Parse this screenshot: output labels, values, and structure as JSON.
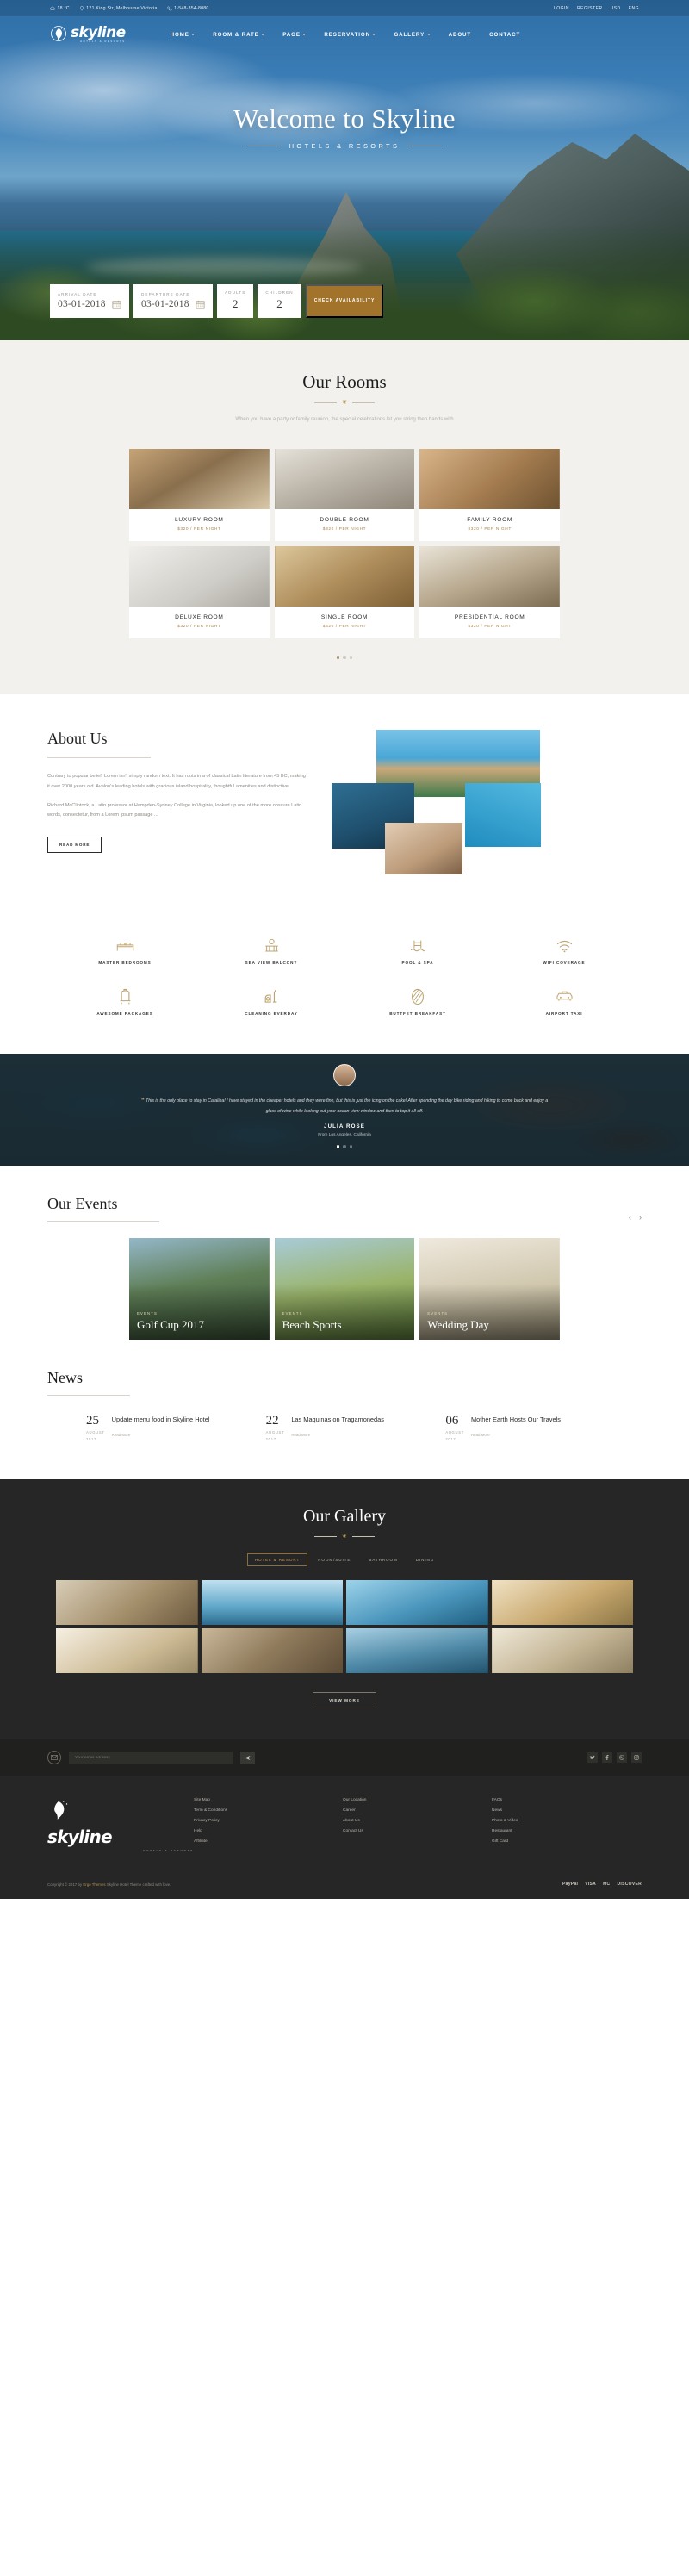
{
  "topbar": {
    "temperature": "18 °C",
    "address": "121 King Str, Melbourne Victoria",
    "phone": "1-548-354-8080",
    "login": "LOGIN",
    "register": "REGISTER",
    "currency": "USD",
    "language": "ENG"
  },
  "brand": {
    "name": "skyline",
    "tagline": "HOTELS & RESORTS"
  },
  "nav": [
    {
      "label": "HOME",
      "caret": true
    },
    {
      "label": "ROOM & RATE",
      "caret": true
    },
    {
      "label": "PAGE",
      "caret": true
    },
    {
      "label": "RESERVATION",
      "caret": true
    },
    {
      "label": "GALLERY",
      "caret": true
    },
    {
      "label": "ABOUT",
      "caret": false
    },
    {
      "label": "CONTACT",
      "caret": false
    }
  ],
  "hero": {
    "title": "Welcome to Skyline",
    "subtitle": "HOTELS & RESORTS",
    "booking": {
      "arrival_label": "ARRIVAL DATE",
      "arrival_value": "03-01-2018",
      "departure_label": "DEPARTURE DATE",
      "departure_value": "03-01-2018",
      "adults_label": "ADULTS",
      "adults_value": "2",
      "children_label": "CHILDREN",
      "children_value": "2",
      "button": "CHECK AVAILABILITY"
    }
  },
  "rooms": {
    "title": "Our Rooms",
    "description": "When you have a party or family reunion, the special celebrations let you string then bands with",
    "items": [
      {
        "name": "LUXURY ROOM",
        "price": "$320 / PER NIGHT"
      },
      {
        "name": "DOUBLE ROOM",
        "price": "$320 / PER NIGHT"
      },
      {
        "name": "FAMILY ROOM",
        "price": "$320 / PER NIGHT"
      },
      {
        "name": "DELUXE ROOM",
        "price": "$320 / PER NIGHT"
      },
      {
        "name": "SINGLE ROOM",
        "price": "$320 / PER NIGHT"
      },
      {
        "name": "PRESIDENTIAL ROOM",
        "price": "$320 / PER NIGHT"
      }
    ]
  },
  "about": {
    "title": "About Us",
    "paragraph1": "Contrary to popular belief, Lorem isn't simply random text. It has roots in a of classical Latin literature from 45 BC, making it over 2000 years old. Avalon's leading hotels with gracious island hospitality, thoughtful amenities and distinctive",
    "paragraph2": "Richard McClintock, a Latin professor at Hampden-Sydney College in Virginia, looked up one of the more obscure Latin words, consectetur, from a Lorem Ipsum passage ...",
    "read_more": "READ MORE"
  },
  "amenities": [
    {
      "label": "MASTER BEDROOMS",
      "icon": "bed-icon"
    },
    {
      "label": "SEA VIEW BALCONY",
      "icon": "balcony-icon"
    },
    {
      "label": "POOL & SPA",
      "icon": "pool-icon"
    },
    {
      "label": "WIFI COVERAGE",
      "icon": "wifi-icon"
    },
    {
      "label": "AWESOME PACKAGES",
      "icon": "luggage-cart-icon"
    },
    {
      "label": "CLEANING EVERDAY",
      "icon": "vacuum-icon"
    },
    {
      "label": "BUTTFET BREAKFAST",
      "icon": "bread-icon"
    },
    {
      "label": "AIRPORT TAXI",
      "icon": "taxi-icon"
    }
  ],
  "testimonial": {
    "quote": "This is the only place to stay in Catalina! I have stayed in the cheaper hotels and they were fine, but this is just the icing on the cake! After spending the day bike riding and hiking to come back and enjoy a glass of wine while looking out your ocean view window and then to top it all off.",
    "name": "JULIA ROSE",
    "from": "From Los Angeles, California"
  },
  "events": {
    "title": "Our Events",
    "prev": "‹",
    "next": "›",
    "items": [
      {
        "tag": "EVENTS",
        "name": "Golf Cup 2017"
      },
      {
        "tag": "EVENTS",
        "name": "Beach Sports"
      },
      {
        "tag": "EVENTS",
        "name": "Wedding Day"
      }
    ]
  },
  "news": {
    "title": "News",
    "items": [
      {
        "day": "25",
        "month": "AUGUST",
        "year": "2017",
        "title": "Update menu food in Skyline Hotel",
        "read_more": "Read More"
      },
      {
        "day": "22",
        "month": "AUGUST",
        "year": "2017",
        "title": "Las Maquinas on Tragamonedas",
        "read_more": "Read More"
      },
      {
        "day": "06",
        "month": "AUGUST",
        "year": "2017",
        "title": "Mother Earth Hosts Our Travels",
        "read_more": "Read More"
      }
    ]
  },
  "gallery": {
    "title": "Our Gallery",
    "tabs": [
      {
        "label": "HOTEL & RESORT",
        "active": true
      },
      {
        "label": "ROOM/SUITE",
        "active": false
      },
      {
        "label": "BATHROOM",
        "active": false
      },
      {
        "label": "DINING",
        "active": false
      }
    ],
    "view_more": "VIEW MORE"
  },
  "subscribe": {
    "placeholder": "Your email address",
    "send_icon": "paper-plane-icon",
    "envelope_icon": "envelope-icon",
    "socials": [
      "twitter-icon",
      "facebook-icon",
      "dribbble-icon",
      "instagram-icon"
    ]
  },
  "footer": {
    "columns": [
      {
        "links": [
          "Site Map",
          "Term & Conditions",
          "Privacy Policy",
          "Help",
          "Affiliate"
        ]
      },
      {
        "links": [
          "Our Location",
          "Career",
          "About Us",
          "Contact Us"
        ]
      },
      {
        "links": [
          "FAQs",
          "News",
          "Photo & Video",
          "Restaurant",
          "Gift Card"
        ]
      }
    ],
    "copyright_pre": "Copyright © 2017 by",
    "copyright_brand": "Ergo Themes",
    "copyright_post": "Skyline Hotel Theme crafted with love.",
    "payments": [
      "PayPal",
      "VISA",
      "MC",
      "DISCOVER"
    ]
  },
  "colors": {
    "accent": "#a2732a",
    "gold": "#b99a5e",
    "dark": "#262626"
  }
}
